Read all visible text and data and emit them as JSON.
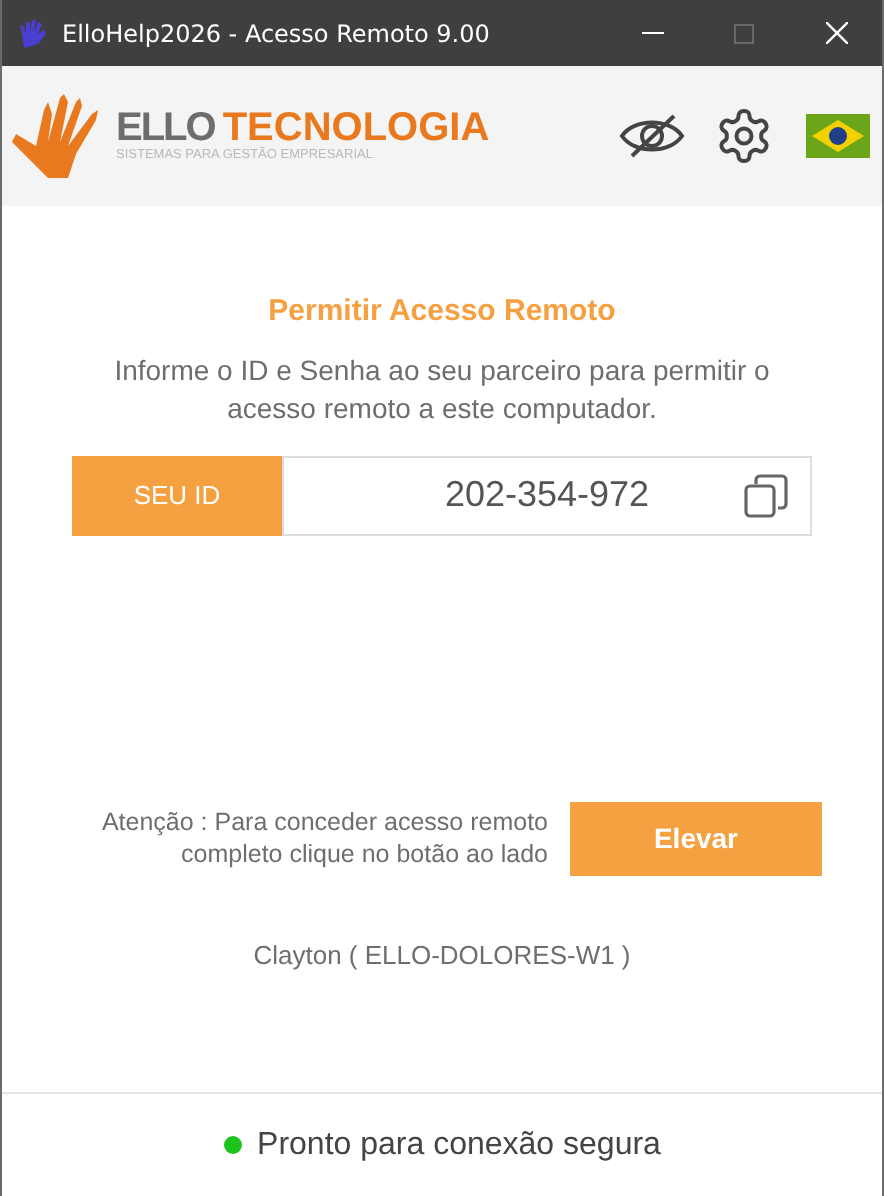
{
  "window": {
    "title": "ElloHelp2026 - Acesso Remoto 9.00",
    "maximize_disabled": true
  },
  "logo": {
    "brand_left": "ELLO",
    "brand_right": "TECNOLOGIA",
    "tagline": "SISTEMAS PARA GESTÃO EMPRESARIAL"
  },
  "panel": {
    "title": "Permitir Acesso Remoto",
    "description": "Informe o ID e Senha ao seu parceiro para permitir o acesso remoto a este computador.",
    "id_label": "SEU ID",
    "id_value": "202-354-972"
  },
  "elevate": {
    "notice": "Atenção : Para conceder acesso remoto completo clique no botão ao lado",
    "button": "Elevar"
  },
  "machine": "Clayton ( ELLO-DOLORES-W1 )",
  "status": {
    "text": "Pronto para conexão segura",
    "connected": true
  }
}
